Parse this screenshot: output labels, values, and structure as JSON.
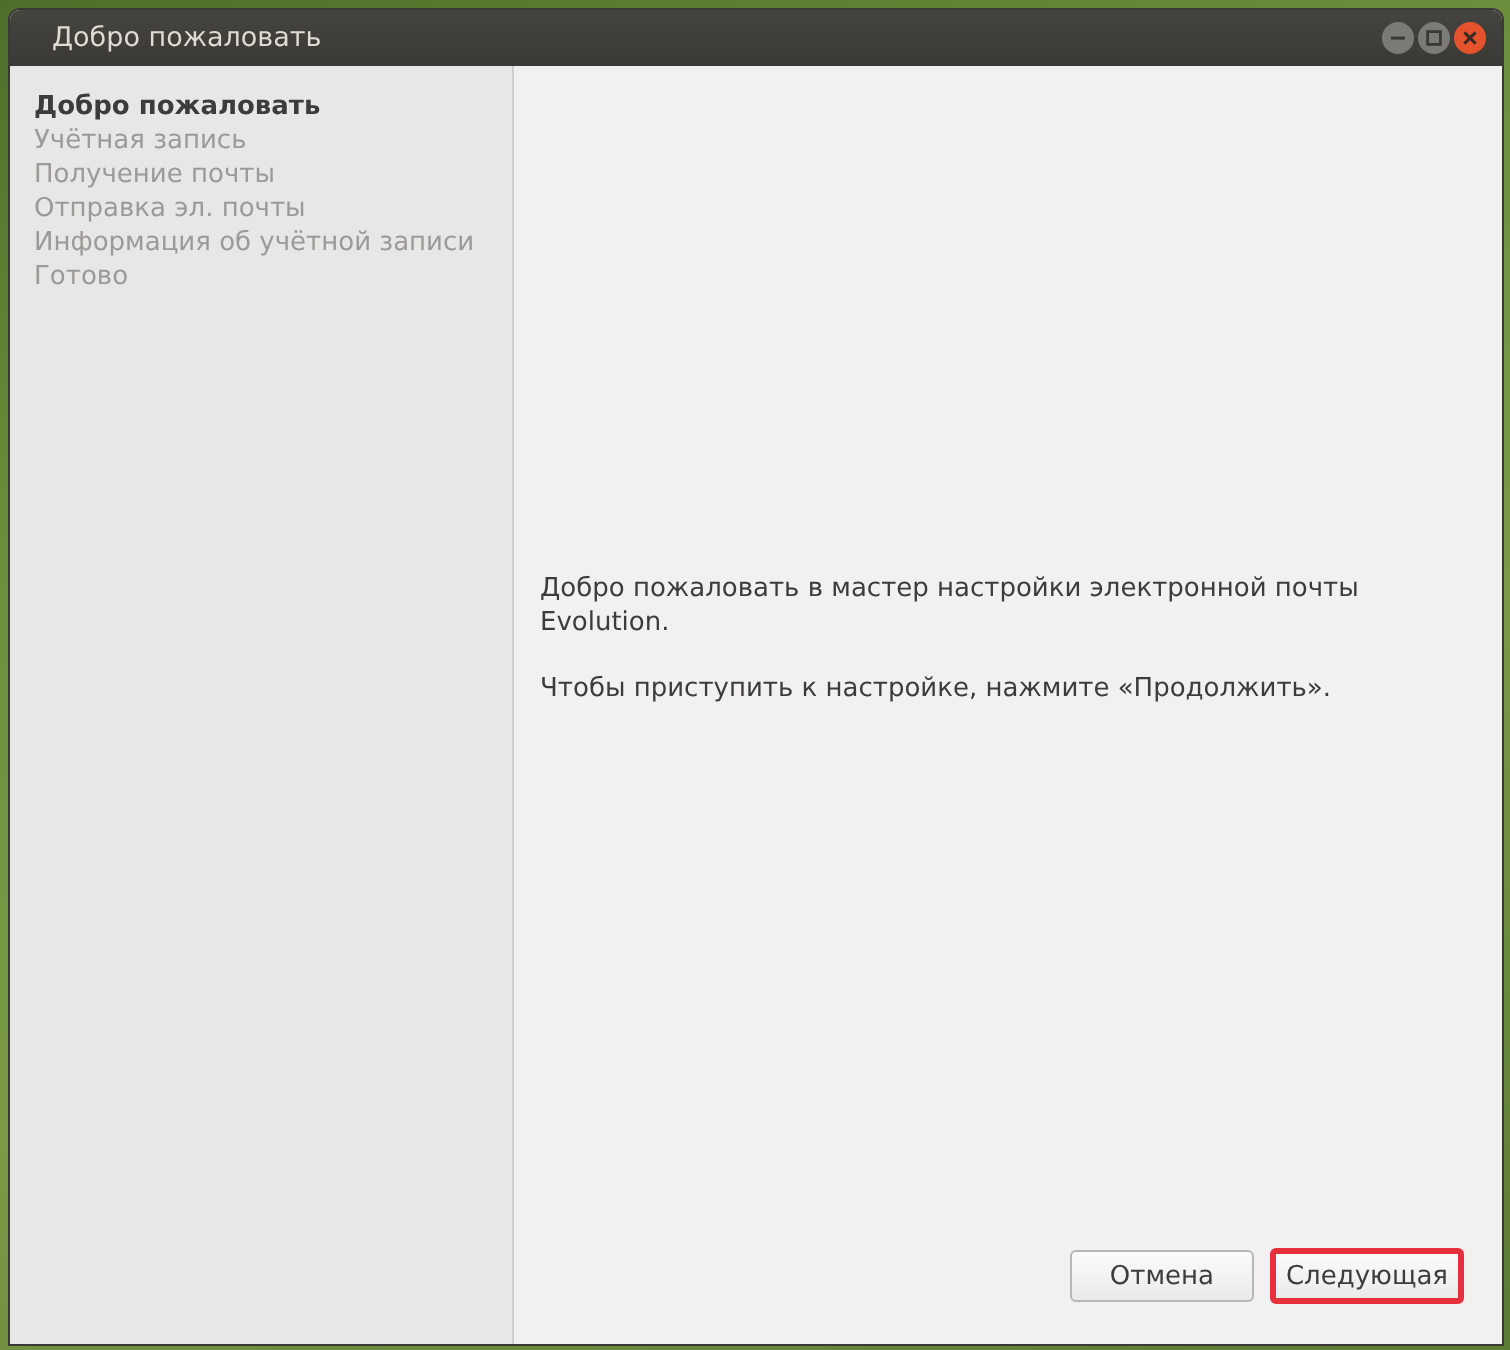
{
  "window": {
    "title": "Добро пожаловать"
  },
  "steps": [
    {
      "label": "Добро пожаловать",
      "selected": true
    },
    {
      "label": "Учётная запись",
      "selected": false
    },
    {
      "label": "Получение почты",
      "selected": false
    },
    {
      "label": "Отправка эл. почты",
      "selected": false
    },
    {
      "label": "Информация об учётной записи",
      "selected": false
    },
    {
      "label": "Готово",
      "selected": false
    }
  ],
  "content": {
    "paragraphs": [
      "Добро пожаловать в мастер настройки электронной почты Evolution.",
      "Чтобы приступить к настройке, нажмите «Продолжить»."
    ]
  },
  "buttons": [
    {
      "label": "Отмена",
      "highlighted": false
    },
    {
      "label": "Следующая",
      "highlighted": true
    }
  ]
}
